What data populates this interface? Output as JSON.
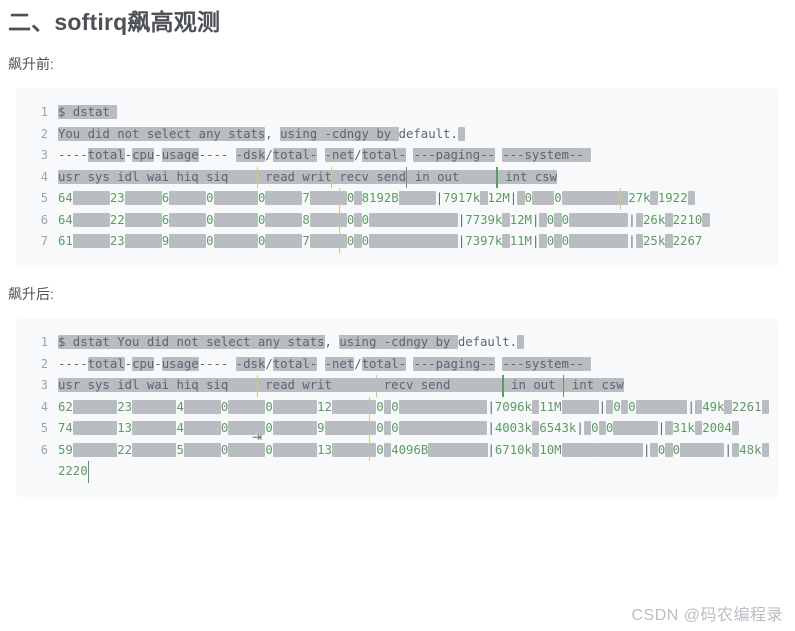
{
  "heading": "二、softirq飙高观测",
  "sections": [
    {
      "caption": "飙升前：",
      "caption_text": "飙升前:",
      "lines": [
        {
          "n": "1",
          "text": "$ dstat"
        },
        {
          "n": "2",
          "text": "You did not select any stats, using -cdngy by default."
        },
        {
          "n": "3",
          "text": "----total-cpu-usage---- -dsk/total- -net/total- ---paging-- ---system--"
        },
        {
          "n": "4",
          "text": "usr sys idl wai hiq siq | read writ| recv send| in out | int csw"
        },
        {
          "n": "5",
          "text": " 64  23   6   0   0   7 |   0  8192B|7917k  12M|   0     0 |  27k 1922"
        },
        {
          "n": "6",
          "text": " 64  22   6   0   0   8 |   0     0 |7739k  12M|   0     0 |  26k 2210"
        },
        {
          "n": "7",
          "text": " 61  23   9   0   0   7 |   0     0 |7397k  11M|   0     0 |  25k 2267"
        }
      ]
    },
    {
      "caption": "飙升后：",
      "caption_text": "飙升后:",
      "lines": [
        {
          "n": "1",
          "text": "$ dstat You did not select any stats, using -cdngy by default."
        },
        {
          "n": "2",
          "text": "----total-cpu-usage---- -dsk/total- -net/total- ---paging-- ---system--"
        },
        {
          "n": "3",
          "text": "usr sys idl wai hiq siq | read writ| recv send| in out | int csw"
        },
        {
          "n": "4",
          "text": " 62  23   4   0   0  12 |   0     0 |7096k  11M|   0     0 |  49k 2261"
        },
        {
          "n": "5",
          "text": " 74  13   4   0   0   9 |   0     0 |4003k 6543k|   0     0 |  31k 2004"
        },
        {
          "n": "6",
          "text": " 59  22   5   0   0  13 |   0  4096B|6710k  10M|   0     0 |  48k 2220"
        }
      ]
    }
  ],
  "watermark": "CSDN @码农编程录",
  "colors": {
    "heading": "#4d5156",
    "code_bg": "#f8f9fb",
    "selection": "#b9bdc2",
    "number": "#5d9b63",
    "text": "#5b6670",
    "linenumber": "#9aa3ab",
    "watermark": "#b9bec4"
  }
}
